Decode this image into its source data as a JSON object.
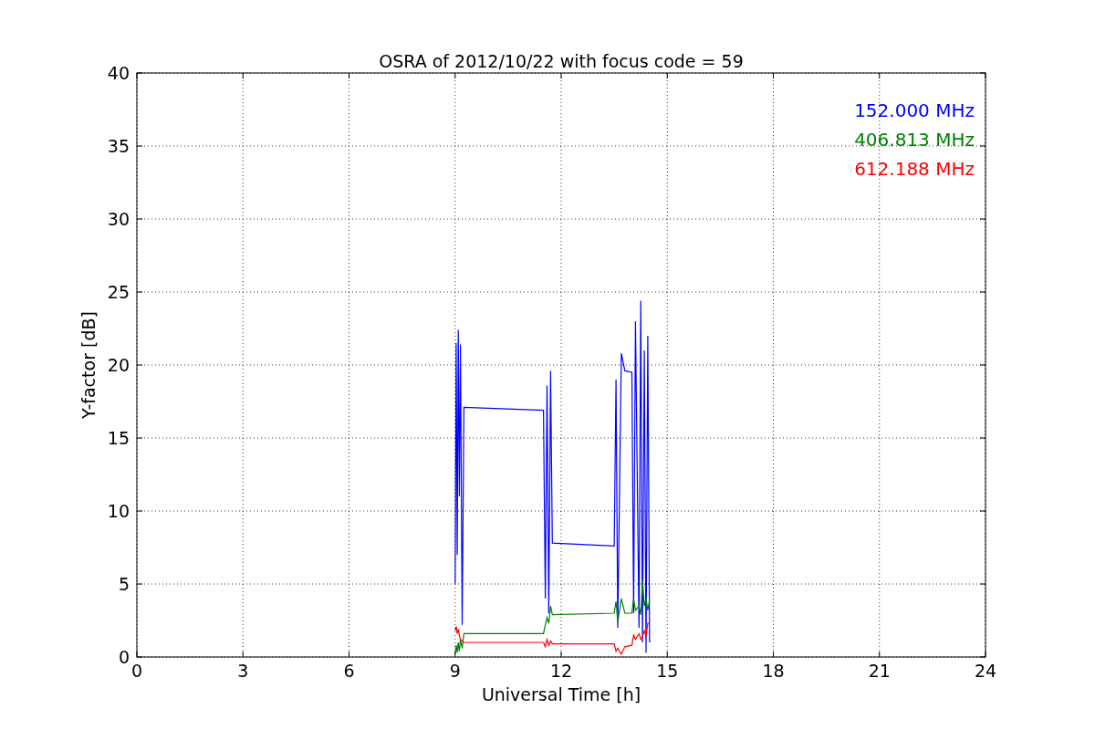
{
  "figure": {
    "chart_data": {
      "type": "line",
      "grid": true,
      "title": "OSRA of 2012/10/22 with focus code = 59",
      "xlabel": "Universal Time [h]",
      "ylabel": "Y-factor [dB]",
      "xlim": [
        0,
        24
      ],
      "ylim": [
        0,
        40
      ],
      "xticks": [
        0,
        3,
        6,
        9,
        12,
        15,
        18,
        21,
        24
      ],
      "yticks": [
        0,
        5,
        10,
        15,
        20,
        25,
        30,
        35,
        40
      ],
      "x": [
        9.0,
        9.03,
        9.06,
        9.09,
        9.12,
        9.15,
        9.2,
        9.25,
        11.5,
        11.55,
        11.6,
        11.65,
        11.7,
        11.75,
        13.5,
        13.55,
        13.6,
        13.7,
        13.8,
        14.0,
        14.05,
        14.1,
        14.2,
        14.25,
        14.3,
        14.35,
        14.4,
        14.45,
        14.5
      ],
      "series": [
        {
          "name": "152.000 MHz",
          "color": "#0000ff",
          "values": [
            5,
            21.5,
            7,
            22.4,
            11,
            21.4,
            2.2,
            17.1,
            16.9,
            4,
            18.6,
            3,
            19.6,
            7.8,
            7.6,
            19,
            2,
            20.8,
            19.6,
            19.5,
            3,
            23,
            2,
            24.4,
            1,
            21,
            0.3,
            22,
            1
          ]
        },
        {
          "name": "406.813 MHz",
          "color": "#008000",
          "values": [
            0.2,
            0.8,
            0.3,
            1,
            0.4,
            1.2,
            0.6,
            1.6,
            1.6,
            2.2,
            2.7,
            2.3,
            3.5,
            2.9,
            3.0,
            3.8,
            2.4,
            4,
            3.0,
            3.0,
            4,
            3.2,
            3.5,
            2.9,
            5.3,
            3.5,
            4,
            3.2,
            4
          ]
        },
        {
          "name": "612.188 MHz",
          "color": "#ff0000",
          "values": [
            1.8,
            2.1,
            1.6,
            1.9,
            1.5,
            1.2,
            1.1,
            1.0,
            1.0,
            0.7,
            1.2,
            0.8,
            1.1,
            0.9,
            0.9,
            0.4,
            0.6,
            0.2,
            0.7,
            0.8,
            1.5,
            1.2,
            1.6,
            1.2,
            1.4,
            1.8,
            1.4,
            2.3,
            2.3
          ]
        }
      ]
    }
  }
}
